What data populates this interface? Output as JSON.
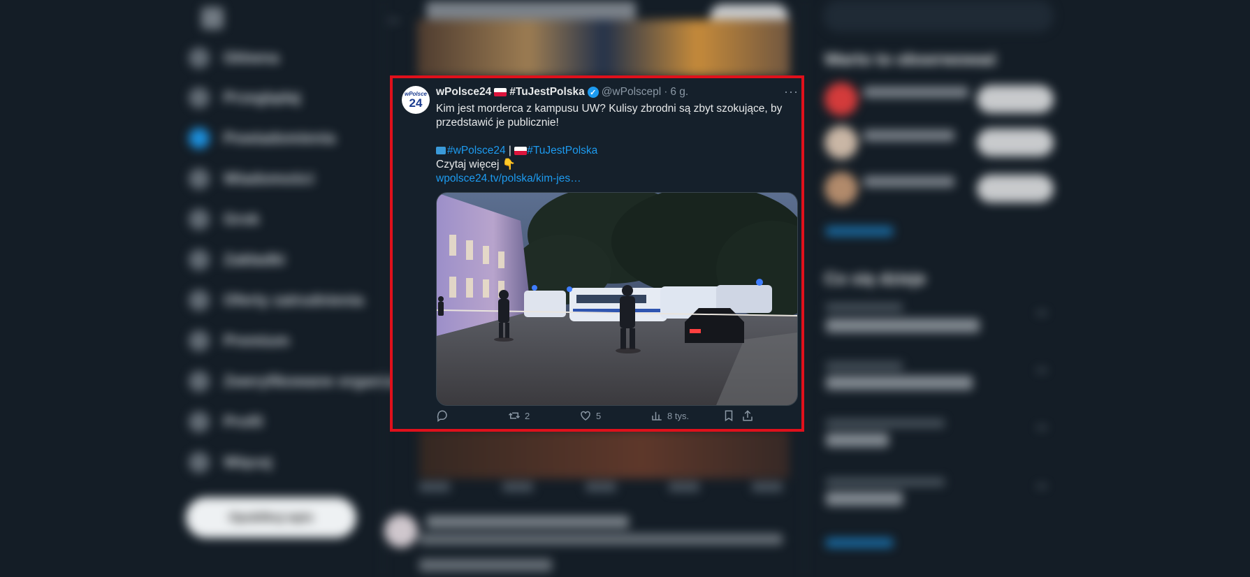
{
  "nav": {
    "items": [
      {
        "label": "Główna"
      },
      {
        "label": "Przeglądaj"
      },
      {
        "label": "Powiadomienia"
      },
      {
        "label": "Wiadomości"
      },
      {
        "label": "Grok"
      },
      {
        "label": "Zakładki"
      },
      {
        "label": "Oferty zatrudnienia"
      },
      {
        "label": "Premium"
      },
      {
        "label": "Zweryfikowane organizacje"
      },
      {
        "label": "Profil"
      },
      {
        "label": "Więcej"
      }
    ],
    "post_label": "Opublikuj wpis"
  },
  "sidebar": {
    "who_to_follow_title": "Warto to obserwować",
    "show_more_label": "Pokaż więcej",
    "whats_happening_title": "Co się dzieje"
  },
  "tweet": {
    "display_name": "wPolsce24",
    "hashtag_name": "#TuJestPolska",
    "handle": "@wPolscepl",
    "separator": "·",
    "time": "6 g.",
    "more": "···",
    "avatar_top": "wPolsce",
    "avatar_bottom": "24",
    "text_line": "Kim jest morderca z kampusu UW? Kulisy zbrodni są zbyt szokujące, by przedstawić je publicznie!",
    "tag1": "#wPolsce24",
    "pipe": " | ",
    "tag2": "#TuJestPolska",
    "read_more": "Czytaj więcej 👇",
    "link_text": "wpolsce24.tv/polska/kim-jes…",
    "stats": {
      "retweets": "2",
      "likes": "5",
      "views": "8 tys."
    }
  },
  "colors": {
    "highlight_border": "#e0101b",
    "accent": "#1d9bf0",
    "background": "#15202b"
  }
}
